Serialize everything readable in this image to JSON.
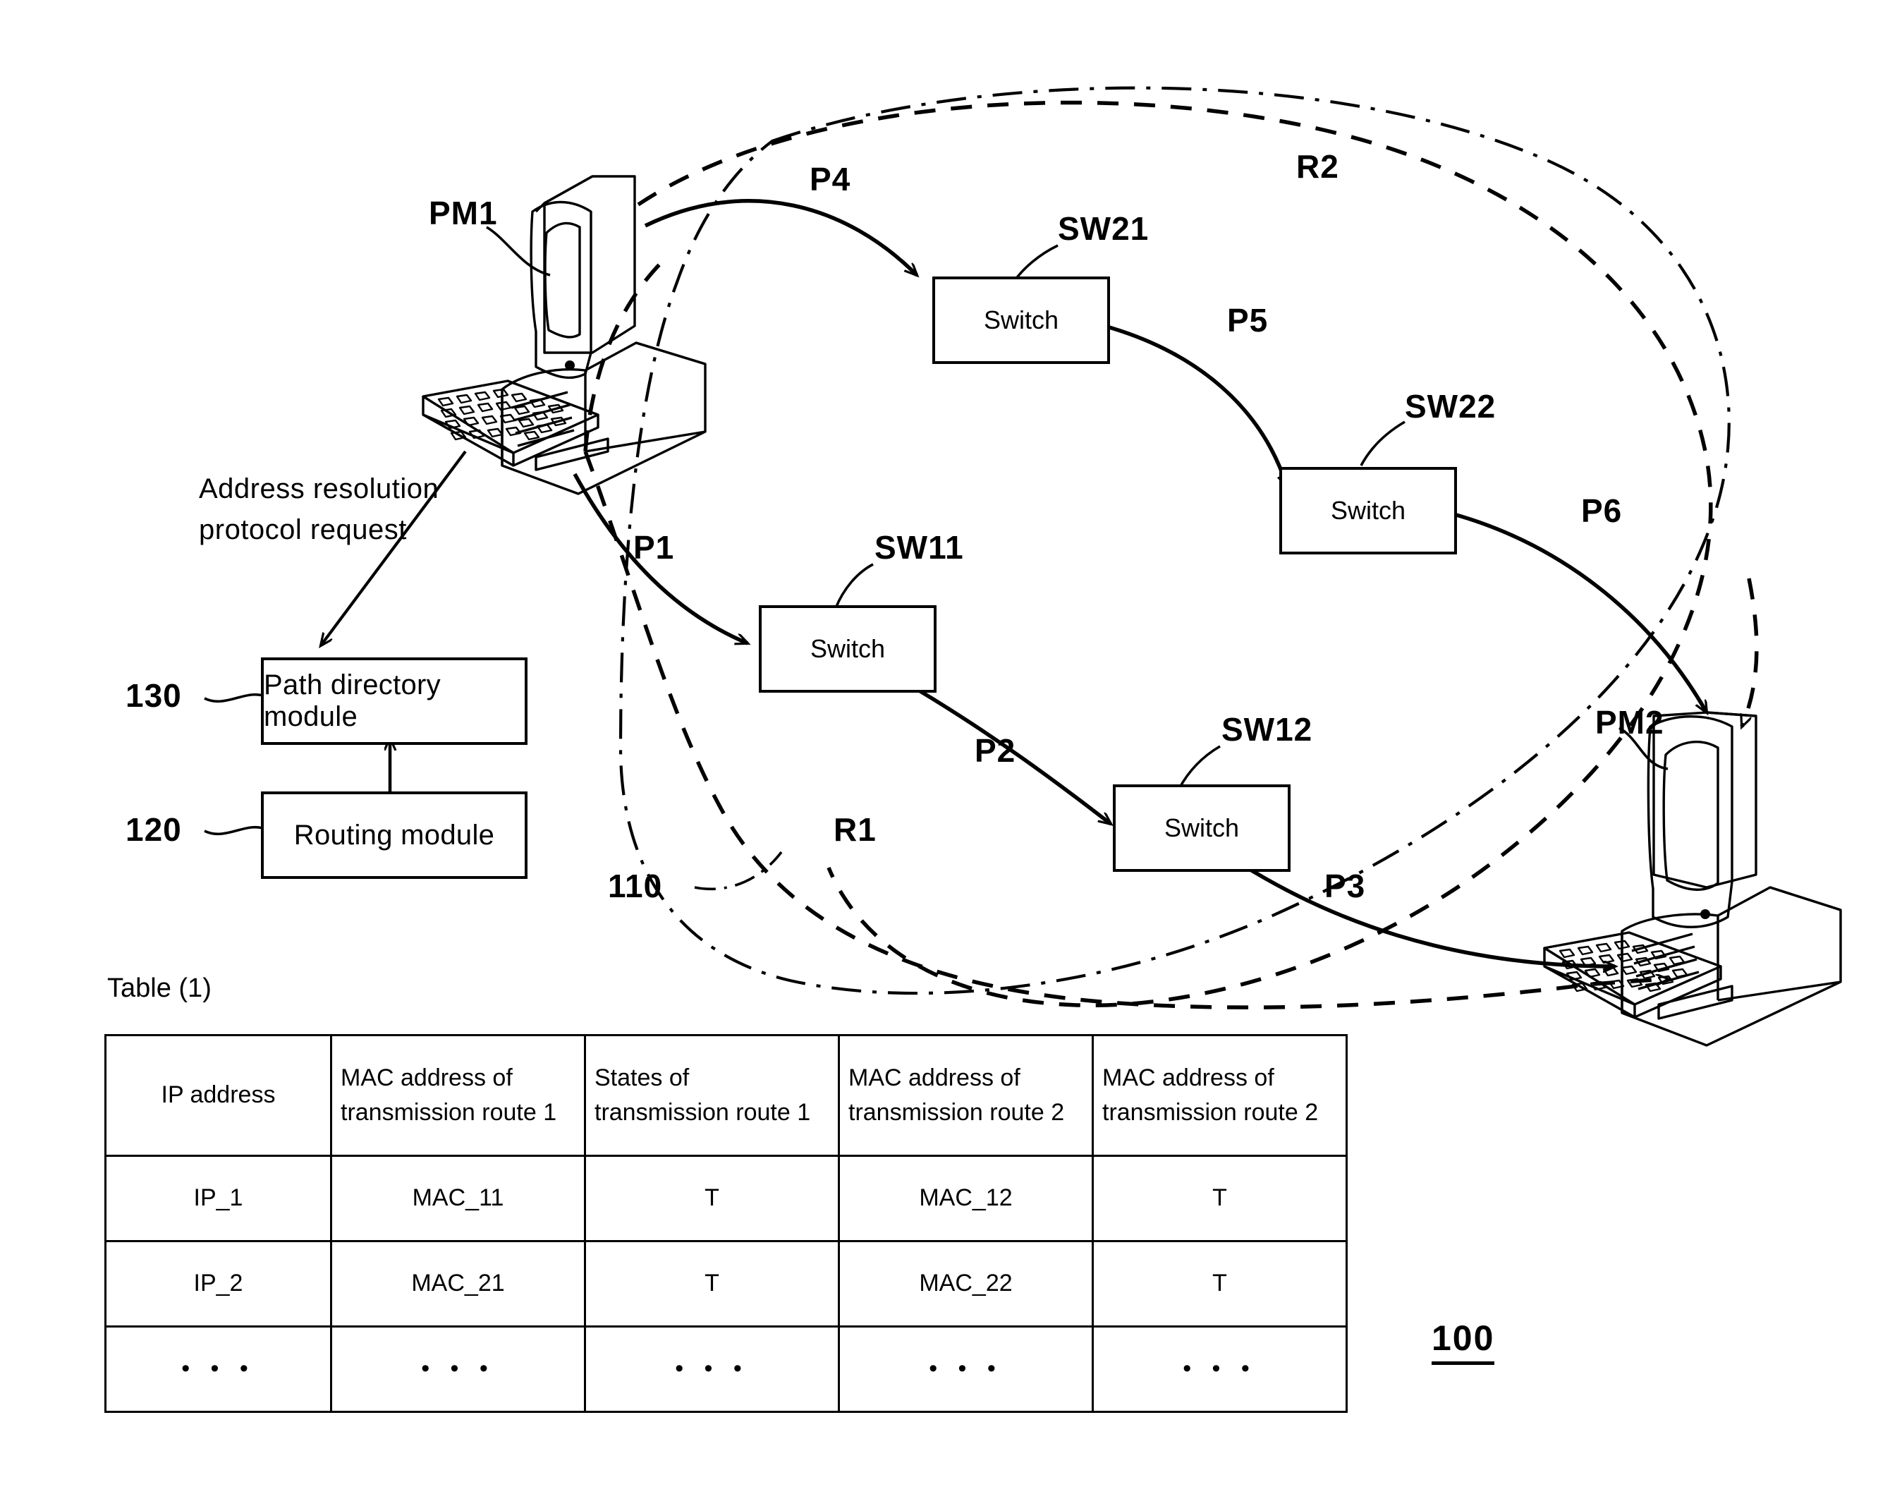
{
  "figure": {
    "figure_number": "100",
    "table_caption": "Table (1)"
  },
  "nodes": {
    "pm1": {
      "label": "PM1",
      "type": "computer"
    },
    "pm2": {
      "label": "PM2",
      "type": "computer"
    },
    "sw11": {
      "label": "SW11",
      "box_text": "Switch"
    },
    "sw12": {
      "label": "SW12",
      "box_text": "Switch"
    },
    "sw21": {
      "label": "SW21",
      "box_text": "Switch"
    },
    "sw22": {
      "label": "SW22",
      "box_text": "Switch"
    }
  },
  "modules": {
    "path_directory": {
      "ref": "130",
      "label": "Path directory module"
    },
    "routing": {
      "ref": "120",
      "label": "Routing module"
    },
    "network": {
      "ref": "110"
    }
  },
  "annotations": {
    "arp_request_line1": "Address resolution",
    "arp_request_line2": "protocol request"
  },
  "paths": {
    "p1": "P1",
    "p2": "P2",
    "p3": "P3",
    "p4": "P4",
    "p5": "P5",
    "p6": "P6"
  },
  "routes": {
    "r1": "R1",
    "r2": "R2"
  },
  "table": {
    "caption": "Table (1)",
    "headers": [
      {
        "line1": "IP address",
        "line2": ""
      },
      {
        "line1": "MAC address of",
        "line2": "transmission route 1"
      },
      {
        "line1": "States of",
        "line2": "transmission route 1"
      },
      {
        "line1": "MAC address of",
        "line2": "transmission route 2"
      },
      {
        "line1": "MAC address of",
        "line2": "transmission route 2"
      }
    ],
    "rows": [
      {
        "ip": "IP_1",
        "mac1": "MAC_11",
        "state1": "T",
        "mac2": "MAC_12",
        "state2": "T"
      },
      {
        "ip": "IP_2",
        "mac1": "MAC_21",
        "state1": "T",
        "mac2": "MAC_22",
        "state2": "T"
      },
      {
        "ip": "• • •",
        "mac1": "• • •",
        "state1": "• • •",
        "mac2": "• • •",
        "state2": "• • •"
      }
    ]
  },
  "colors": {
    "ink": "#000000",
    "paper": "#ffffff"
  }
}
